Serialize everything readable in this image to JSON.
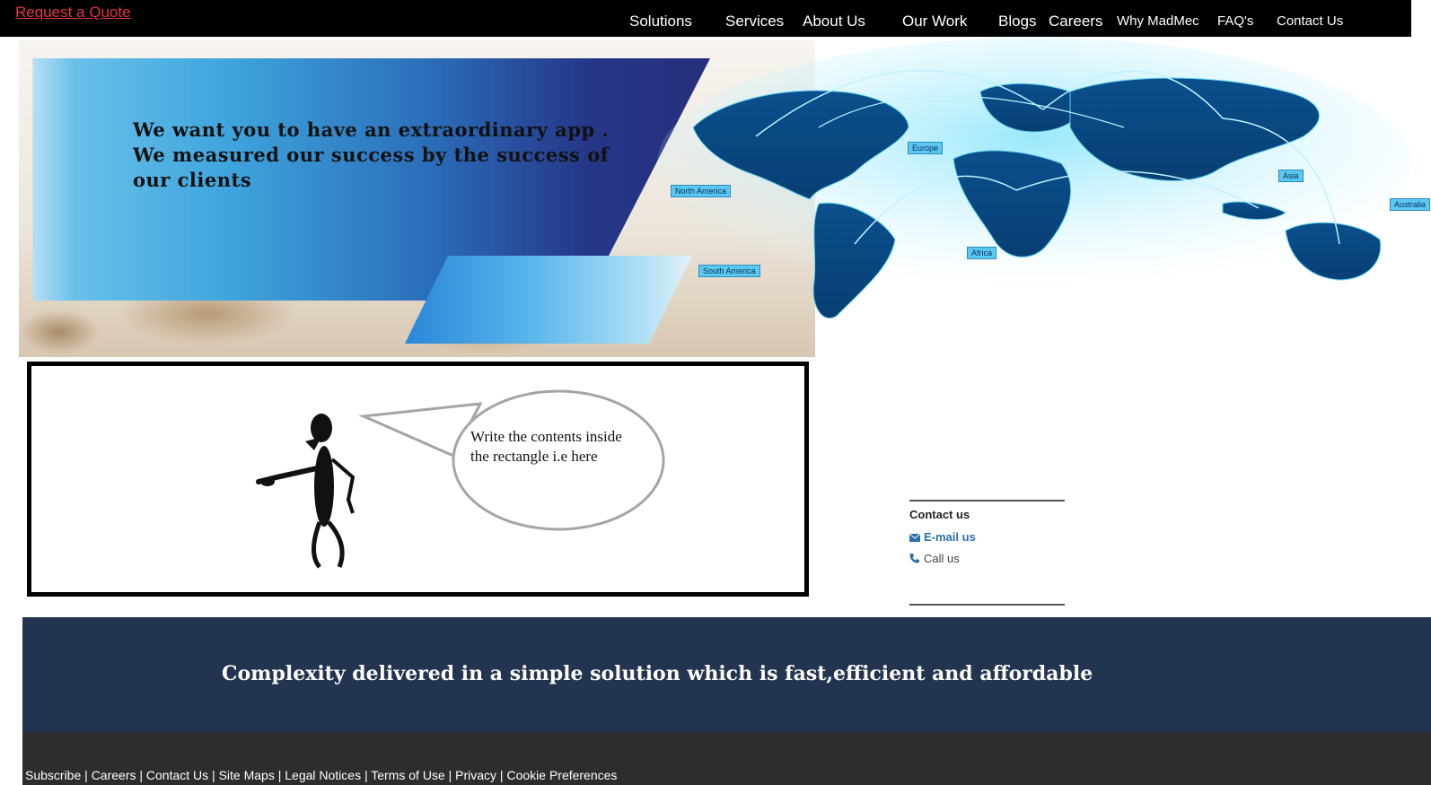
{
  "header": {
    "quote_link": "Request a Quote",
    "nav": [
      {
        "label": "Solutions"
      },
      {
        "label": "Services"
      },
      {
        "label": "About Us"
      },
      {
        "label": "Our Work"
      },
      {
        "label": "Blogs"
      },
      {
        "label": "Careers"
      },
      {
        "label": "Why MadMec"
      },
      {
        "label": "FAQ's"
      },
      {
        "label": "Contact Us"
      }
    ]
  },
  "hero": {
    "text": "We want you to have an extraordinary app . We measured our success by the success of our clients",
    "map_labels": [
      "North America",
      "Europe",
      "Asia",
      "Africa",
      "South America",
      "Australia"
    ]
  },
  "comic": {
    "bubble_text": "Write the contents inside the rectangle i.e here"
  },
  "contact": {
    "title": "Contact us",
    "email": "E-mail us",
    "call": "Call us"
  },
  "tagline": "Complexity delivered in a simple solution which is fast,efficient and affordable",
  "footer": {
    "links": [
      "Subscribe",
      "Careers",
      "Contact Us",
      "Site Maps",
      "Legal Notices",
      "Terms of Use",
      "Privacy",
      "Cookie Preferences"
    ]
  },
  "colors": {
    "nav_bg": "#000000",
    "quote_link": "#e2363b",
    "tagline_bg": "#22344f",
    "footer_bg": "#2d2d2d",
    "email_link": "#2d6fa8"
  }
}
